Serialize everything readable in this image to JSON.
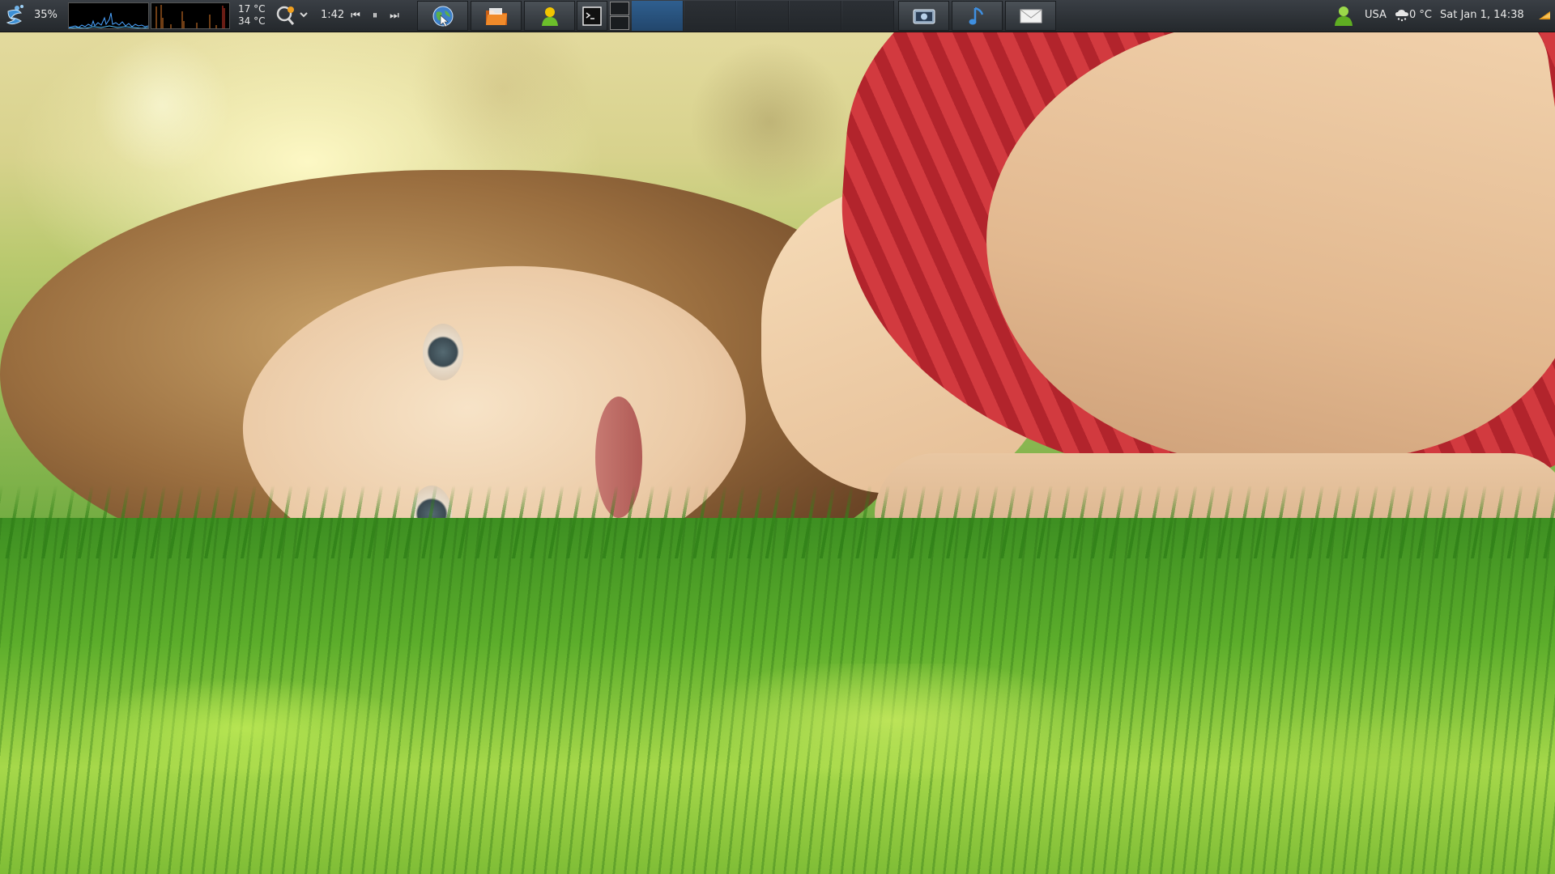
{
  "panel": {
    "cpu_percent": "35%",
    "temps": [
      "17 °C",
      "34 °C"
    ],
    "media": {
      "time": "1:42",
      "prev_label": "⏮",
      "pause_label": "⏸",
      "next_label": "⏭"
    },
    "locale": "USA",
    "weather_temp": "0 °C",
    "clock": "Sat Jan  1, 14:38",
    "icons": {
      "menu": "application-menu-icon",
      "weather_tool": "weather-tool-icon",
      "browser": "globe-icon",
      "files": "folder-icon",
      "im": "chat-contact-icon",
      "terminal": "terminal-icon",
      "screenshot": "screenshot-icon",
      "music": "music-note-icon",
      "mail": "envelope-icon",
      "user": "user-icon",
      "weather": "snow-cloud-icon"
    },
    "colors": {
      "panel_bg": "#2a2e33",
      "active_workspace": "#2f5f8f"
    }
  }
}
